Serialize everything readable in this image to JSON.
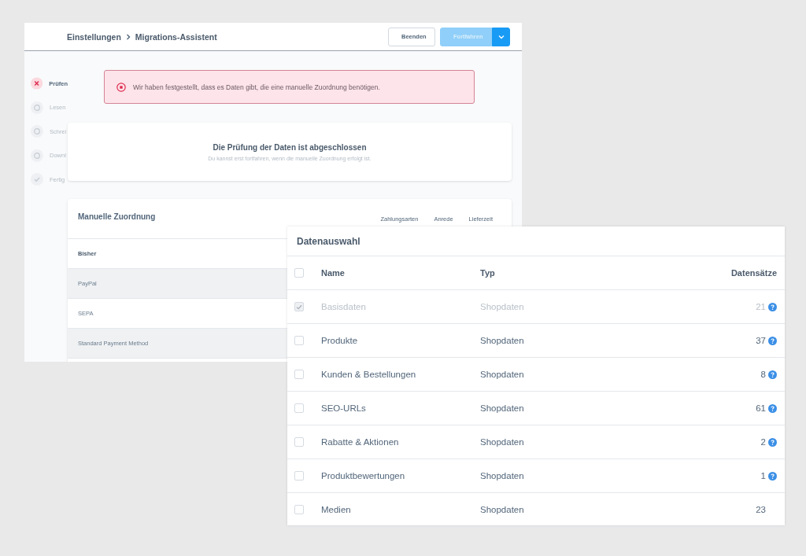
{
  "settings_window": {
    "breadcrumb": [
      "Einstellungen",
      "Migrations-Assistent"
    ],
    "buttons": [
      {
        "label": "Beenden",
        "kind": "secondary"
      },
      {
        "label": "Fortfahren",
        "kind": "primary",
        "disabled": true
      }
    ],
    "steps": [
      {
        "label": "Prüfen",
        "kind": "error"
      },
      {
        "label": "Lesen",
        "kind": "pending"
      },
      {
        "label": "Schrei",
        "kind": "pending"
      },
      {
        "label": "Downl",
        "kind": "pending"
      },
      {
        "label": "Fertig",
        "kind": "done"
      }
    ],
    "alert": {
      "kind": "error",
      "text": "Wir haben festgestellt, dass es Daten gibt, die eine manuelle Zuordnung benötigen."
    },
    "status_card": {
      "title": "Die Prüfung der Daten ist abgeschlossen",
      "subtitle": "Du kannst erst fortfahren, wenn die manuelle Zuordnung erfolgt ist."
    },
    "mapping_card": {
      "title": "Manuelle Zuordnung",
      "tabs": [
        "Zahlungsarten",
        "Anrede",
        "Lieferzeit"
      ],
      "columns": [
        "Bisher"
      ],
      "rows": [
        {
          "cells": [
            "PayPal"
          ],
          "highlighted": true
        },
        {
          "cells": [
            "SEPA"
          ],
          "highlighted": false
        },
        {
          "cells": [
            "Standard Payment Method"
          ],
          "highlighted": true
        }
      ]
    }
  },
  "data_selection": {
    "title": "Datenauswahl",
    "columns": [
      "Name",
      "Typ",
      "Datensätze"
    ],
    "all_checked": false,
    "rows": [
      {
        "name": "Basisdaten",
        "type": "Shopdaten",
        "count": "21",
        "checked": true,
        "disabled": true,
        "help": true
      },
      {
        "name": "Produkte",
        "type": "Shopdaten",
        "count": "37",
        "checked": false,
        "disabled": false,
        "help": true
      },
      {
        "name": "Kunden & Bestellungen",
        "type": "Shopdaten",
        "count": "8",
        "checked": false,
        "disabled": false,
        "help": true
      },
      {
        "name": "SEO-URLs",
        "type": "Shopdaten",
        "count": "61",
        "checked": false,
        "disabled": false,
        "help": true
      },
      {
        "name": "Rabatte & Aktionen",
        "type": "Shopdaten",
        "count": "2",
        "checked": false,
        "disabled": false,
        "help": true
      },
      {
        "name": "Produktbewertungen",
        "type": "Shopdaten",
        "count": "1",
        "checked": false,
        "disabled": false,
        "help": true
      },
      {
        "name": "Medien",
        "type": "Shopdaten",
        "count": "23",
        "checked": false,
        "disabled": false,
        "help": false
      }
    ]
  }
}
